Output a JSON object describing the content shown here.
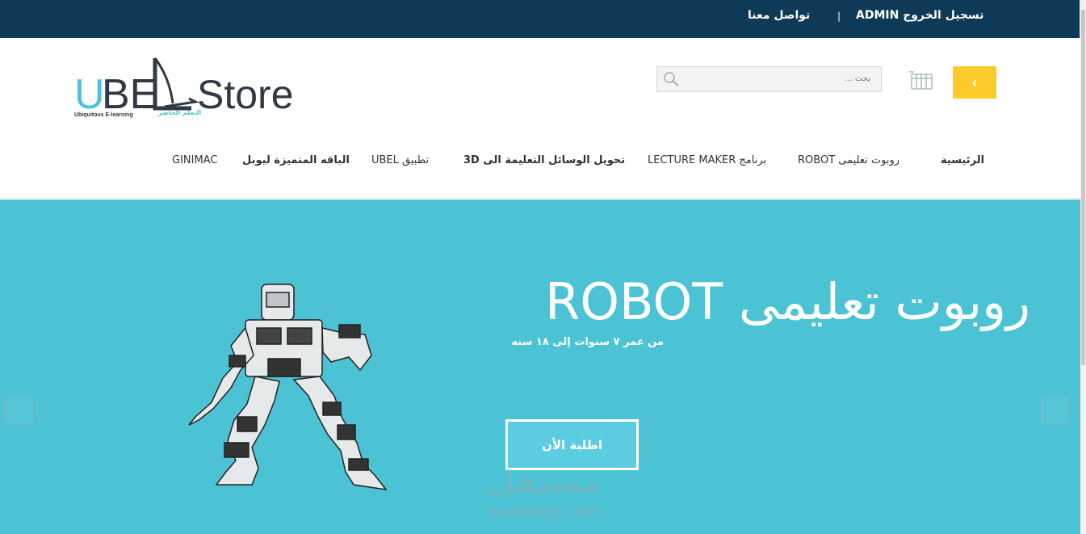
{
  "topbar": {
    "logout_label": "تسجيل الخروج ADMIN",
    "separator": "|",
    "contact_label": "تواصل معنا"
  },
  "logo": {
    "brand": "UBEL",
    "store": "Store",
    "tagline_en": "Ubiquitous E-learning",
    "tagline_ar": "التعلم الحاضر"
  },
  "search": {
    "placeholder": "بحث ..."
  },
  "cart_button": {
    "label": "‹"
  },
  "nav": {
    "items": [
      {
        "label": "الرئيسية"
      },
      {
        "label": "روبوت تعليمى ROBOT"
      },
      {
        "label": "برنامج LECTURE MAKER"
      },
      {
        "label": "تحويل الوسائل التعليمة الى 3D"
      },
      {
        "label": "تطبيق UBEL"
      },
      {
        "label": "الباقه المتميزة ليوبل"
      },
      {
        "label": "GINIMAC"
      }
    ]
  },
  "hero": {
    "title": "روبوت تعليمى ROBOT",
    "subtitle": "من عمر ٧ سنوات إلى ١٨ سنه",
    "order_button": "اطلبة الأن"
  },
  "watermark": {
    "ar": "مستقل",
    "en": "mostaql.com"
  },
  "colors": {
    "topbar": "#0e3a57",
    "hero": "#4cc3d4",
    "cart": "#fccb29",
    "brand_accent": "#4cc3d4"
  }
}
